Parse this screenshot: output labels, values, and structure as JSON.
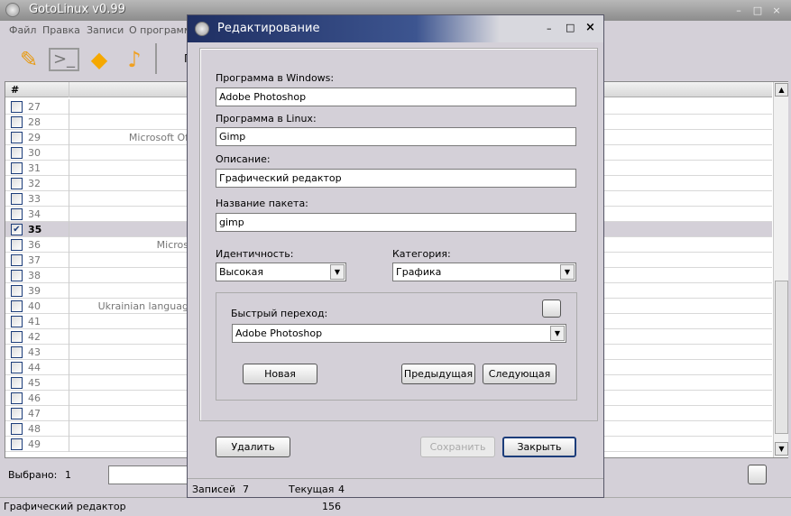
{
  "window": {
    "title": "GotoLinux v0.99"
  },
  "menu": [
    "Файл",
    "Правка",
    "Записи",
    "О программе"
  ],
  "toolbar": {
    "partial_label": "П"
  },
  "grid": {
    "header": "#",
    "rows": [
      {
        "n": "27",
        "text": "",
        "checked": false
      },
      {
        "n": "28",
        "text": "",
        "checked": false
      },
      {
        "n": "29",
        "text": "Microsoft Of",
        "checked": false
      },
      {
        "n": "30",
        "text": "",
        "checked": false
      },
      {
        "n": "31",
        "text": "",
        "checked": false
      },
      {
        "n": "32",
        "text": "",
        "checked": false
      },
      {
        "n": "33",
        "text": "",
        "checked": false
      },
      {
        "n": "34",
        "text": "",
        "checked": false
      },
      {
        "n": "35",
        "text": "",
        "checked": true
      },
      {
        "n": "36",
        "text": "Micros",
        "checked": false
      },
      {
        "n": "37",
        "text": "",
        "checked": false
      },
      {
        "n": "38",
        "text": "",
        "checked": false
      },
      {
        "n": "39",
        "text": "",
        "checked": false
      },
      {
        "n": "40",
        "text": "Ukrainian languag",
        "checked": false
      },
      {
        "n": "41",
        "text": "",
        "checked": false
      },
      {
        "n": "42",
        "text": "",
        "checked": false
      },
      {
        "n": "43",
        "text": "",
        "checked": false
      },
      {
        "n": "44",
        "text": "",
        "checked": false
      },
      {
        "n": "45",
        "text": "",
        "checked": false
      },
      {
        "n": "46",
        "text": "",
        "checked": false
      },
      {
        "n": "47",
        "text": "",
        "checked": false
      },
      {
        "n": "48",
        "text": "",
        "checked": false
      },
      {
        "n": "49",
        "text": "",
        "checked": false
      }
    ]
  },
  "bottom": {
    "selected_label": "Выбрано:",
    "selected_count": "1"
  },
  "statusbar": {
    "text": "Графический редактор",
    "number": "156"
  },
  "dialog": {
    "title": "Редактирование",
    "win_label": "Программа в Windows:",
    "win_value": "Adobe Photoshop",
    "linux_label": "Программа в Linux:",
    "linux_value": "Gimp",
    "desc_label": "Описание:",
    "desc_value": "Графический редактор",
    "pkg_label": "Название пакета:",
    "pkg_value": "gimp",
    "ident_label": "Идентичность:",
    "ident_value": "Высокая",
    "cat_label": "Категория:",
    "cat_value": "Графика",
    "jump_label": "Быстрый переход:",
    "jump_value": "Adobe Photoshop",
    "new_btn": "Новая",
    "prev_btn": "Предыдущая",
    "next_btn": "Следующая",
    "delete_btn": "Удалить",
    "save_btn": "Сохранить",
    "close_btn": "Закрыть",
    "records_label": "Записей",
    "records_value": "7",
    "current_label": "Текущая",
    "current_value": "4"
  }
}
